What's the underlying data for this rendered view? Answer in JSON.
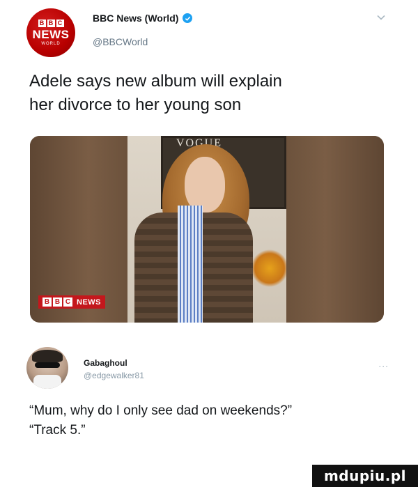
{
  "tweet": {
    "avatar": {
      "blocks": [
        "B",
        "B",
        "C"
      ],
      "word": "NEWS",
      "subword": "WORLD"
    },
    "display_name": "BBC News (World)",
    "handle": "@BBCWorld",
    "text_line_1": "Adele says new album will explain",
    "text_line_2": "her divorce to her young son",
    "media": {
      "magazine_text": "VOGUE",
      "badge_blocks": [
        "B",
        "B",
        "C"
      ],
      "badge_label": "NEWS"
    }
  },
  "reply": {
    "display_name": "Gabaghoul",
    "handle": "@edgewalker81",
    "more": "...",
    "text_line_1": "“Mum, why do I only see dad on weekends?”",
    "text_line_2": "“Track 5.”"
  },
  "watermark": {
    "text": "mdupiu.pl"
  },
  "colors": {
    "bbc_red": "#b80000",
    "verified_blue": "#1da1f2"
  },
  "icons": {
    "verified": "verified-check-icon",
    "dropdown": "chevron-down-icon",
    "more": "more-icon"
  }
}
